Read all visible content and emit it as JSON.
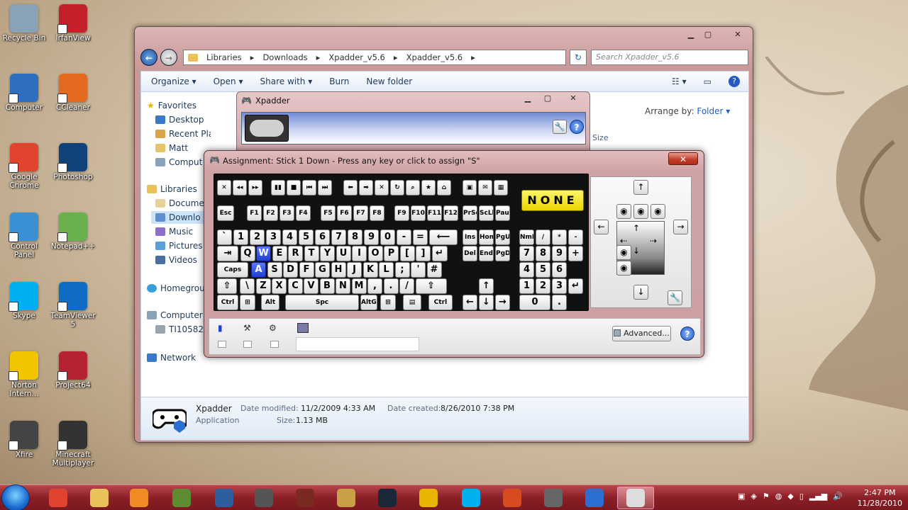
{
  "desktop": {
    "icons": [
      {
        "label": "Recycle Bin",
        "color": "#8aa2b8"
      },
      {
        "label": "IrfanView",
        "color": "#c4202a"
      },
      {
        "label": "Computer",
        "color": "#2f6fc0"
      },
      {
        "label": "CCleaner",
        "color": "#e56a1f"
      },
      {
        "label": "Google Chrome",
        "color": "#e0442e"
      },
      {
        "label": "Photoshop",
        "color": "#10437a"
      },
      {
        "label": "Control Panel",
        "color": "#3b8fd3"
      },
      {
        "label": "Notepad++",
        "color": "#6ab04c"
      },
      {
        "label": "Skype",
        "color": "#00aff0"
      },
      {
        "label": "TeamViewer 5",
        "color": "#0e6cc4"
      },
      {
        "label": "Norton Intern...",
        "color": "#f2c500"
      },
      {
        "label": "Project64",
        "color": "#b52233"
      },
      {
        "label": "Xfire",
        "color": "#444444"
      },
      {
        "label": "Minecraft Multiplayer",
        "color": "#333333"
      }
    ]
  },
  "explorer": {
    "controls": {
      "minimize": "▁",
      "maximize": "▢",
      "close": "✕"
    },
    "breadcrumb": [
      "Libraries",
      "Downloads",
      "Xpadder_v5.6",
      "Xpadder_v5.6"
    ],
    "search_placeholder": "Search Xpadder_v5.6",
    "toolbar": {
      "organize": "Organize ▾",
      "open": "Open ▾",
      "share": "Share with ▾",
      "burn": "Burn",
      "new_folder": "New folder"
    },
    "nav": {
      "favorites": "Favorites",
      "desktop": "Desktop",
      "recent": "Recent Places",
      "matt": "Matt",
      "computer_fav": "Comput",
      "libraries": "Libraries",
      "documents": "Docume",
      "downloads": "Downlo",
      "music": "Music",
      "pictures": "Pictures",
      "videos": "Videos",
      "homegroup": "Homegrou",
      "computer": "Computer",
      "drive": "TI10582",
      "network": "Network"
    },
    "arrange_label": "Arrange by:",
    "arrange_value": "Folder ▾",
    "size_col": "Size",
    "details": {
      "name": "Xpadder",
      "type": "Application",
      "modified_label": "Date modified:",
      "modified_value": "11/2/2009 4:33 AM",
      "size_label": "Size:",
      "size_value": "1.13 MB",
      "created_label": "Date created:",
      "created_value": "8/26/2010 7:38 PM"
    }
  },
  "xpadder": {
    "title": "Xpadder",
    "controls": {
      "minimize": "▁",
      "maximize": "▢",
      "close": "✕"
    }
  },
  "assignment": {
    "title": "Assignment: Stick 1 Down - Press any key or click to assign \"S\"",
    "close": "✕",
    "none_label": "NONE",
    "advanced_label": "Advanced...",
    "help_label": "?",
    "keys": {
      "media": [
        "✕",
        "◂◂",
        "▸▸",
        "▮▮",
        "■",
        "⏮",
        "⏭",
        "⬅",
        "➡",
        "✕",
        "↻",
        "⌕",
        "★",
        "⌂",
        "▣",
        "✉",
        "▦"
      ],
      "esc": "Esc",
      "fkeys": [
        "F1",
        "F2",
        "F3",
        "F4",
        "F5",
        "F6",
        "F7",
        "F8",
        "F9",
        "F10",
        "F11",
        "F12"
      ],
      "sys": [
        "PrSc",
        "ScLk",
        "Pause"
      ],
      "row1": [
        "`",
        "1",
        "2",
        "3",
        "4",
        "5",
        "6",
        "7",
        "8",
        "9",
        "0",
        "-",
        "=",
        "⟵"
      ],
      "row2": [
        "⇥",
        "Q",
        "W",
        "E",
        "R",
        "T",
        "Y",
        "U",
        "I",
        "O",
        "P",
        "[",
        "]",
        "↵"
      ],
      "row3": [
        "Caps",
        "A",
        "S",
        "D",
        "F",
        "G",
        "H",
        "J",
        "K",
        "L",
        ";",
        "'",
        "#"
      ],
      "row4": [
        "⇧",
        "\\",
        "Z",
        "X",
        "C",
        "V",
        "B",
        "N",
        "M",
        ",",
        ".",
        "/",
        "⇧"
      ],
      "row5": [
        "Ctrl",
        "⊞",
        "Alt",
        "Spc",
        "AltGr",
        "⊞",
        "▤",
        "Ctrl"
      ],
      "nav1": [
        "Ins",
        "Home",
        "PgUp"
      ],
      "nav2": [
        "Del",
        "End",
        "PgDn"
      ],
      "arrows": [
        "↑",
        "←",
        "↓",
        "→"
      ],
      "np1": [
        "NmLk",
        "/",
        "*",
        "-"
      ],
      "np2": [
        "7",
        "8",
        "9",
        "+"
      ],
      "np3": [
        "4",
        "5",
        "6"
      ],
      "np4": [
        "1",
        "2",
        "3",
        "↵"
      ],
      "np5": [
        "0",
        "."
      ]
    }
  },
  "taskbar": {
    "apps": [
      {
        "name": "chrome",
        "color": "#e0442e"
      },
      {
        "name": "explorer",
        "color": "#e9c25a"
      },
      {
        "name": "media-player",
        "color": "#f08a24"
      },
      {
        "name": "minecraft",
        "color": "#5d8c33"
      },
      {
        "name": "app-blue",
        "color": "#2e5e9e"
      },
      {
        "name": "app-shield",
        "color": "#555555"
      },
      {
        "name": "app-skull",
        "color": "#7a2a20"
      },
      {
        "name": "app-photo",
        "color": "#c9a046"
      },
      {
        "name": "steam",
        "color": "#1b2838"
      },
      {
        "name": "app-v",
        "color": "#e8b400"
      },
      {
        "name": "skype",
        "color": "#00aff0"
      },
      {
        "name": "app-flame",
        "color": "#d84a1f"
      },
      {
        "name": "app-tools",
        "color": "#666666"
      },
      {
        "name": "app-square",
        "color": "#2a6fd1"
      },
      {
        "name": "xpadder",
        "color": "#dddddd"
      }
    ],
    "time": "2:47 PM",
    "date": "11/28/2010"
  }
}
